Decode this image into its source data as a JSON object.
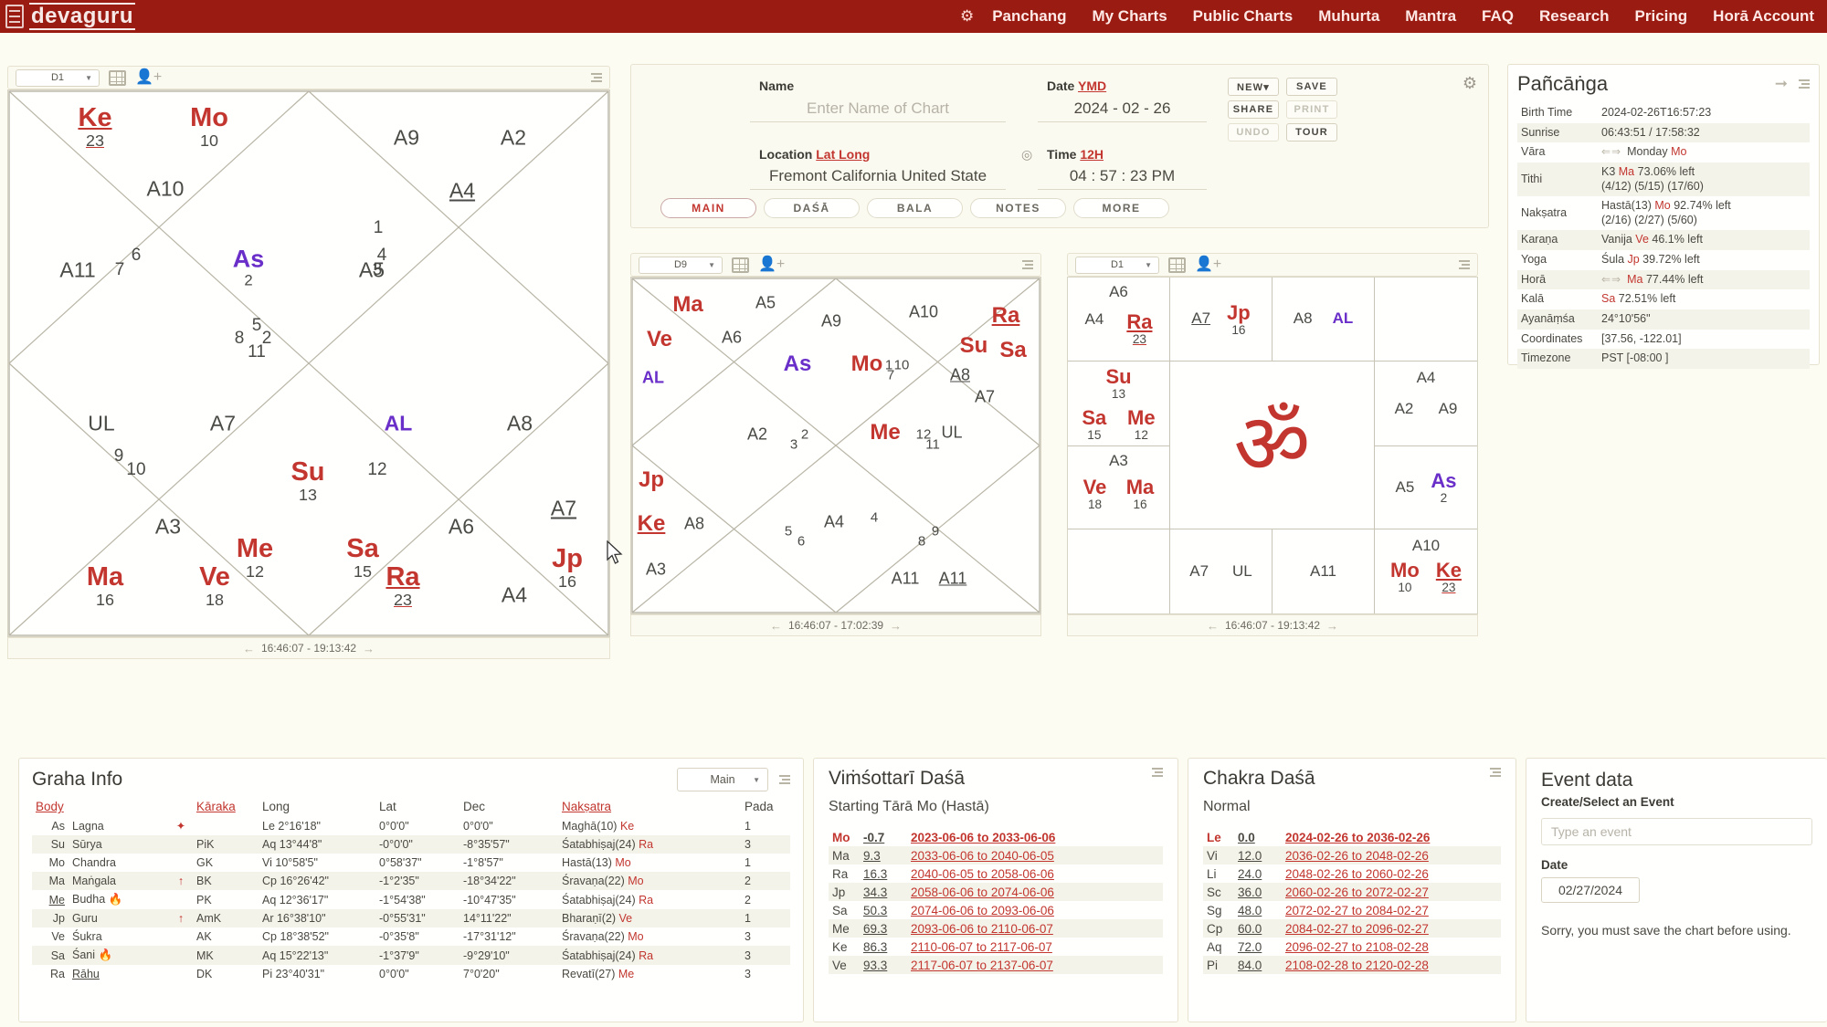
{
  "app": {
    "brand": "devaguru",
    "nav": [
      {
        "label": "Panchang"
      },
      {
        "label": "My Charts"
      },
      {
        "label": "Public Charts"
      },
      {
        "label": "Muhurta"
      },
      {
        "label": "Mantra"
      },
      {
        "label": "FAQ"
      },
      {
        "label": "Research"
      },
      {
        "label": "Pricing"
      },
      {
        "label": "Horā Account"
      }
    ],
    "nav_gear_icon": "gear-icon"
  },
  "form": {
    "name_label": "Name",
    "name_placeholder": "Enter Name of Chart",
    "name_value": "",
    "location_label": "Location",
    "location_link": "Lat Long",
    "location_value": "Fremont California United State",
    "date_label": "Date",
    "date_format_link": "YMD",
    "date_value": "2024 - 02 - 26",
    "time_label": "Time",
    "time_format_link": "12H",
    "time_value": "04 : 57 : 23",
    "time_meridiem": "PM",
    "buttons": [
      {
        "label": "NEW▾",
        "enabled": true
      },
      {
        "label": "SAVE",
        "enabled": true
      },
      {
        "label": "SHARE",
        "enabled": true
      },
      {
        "label": "PRINT",
        "enabled": false
      },
      {
        "label": "UNDO",
        "enabled": false
      },
      {
        "label": "TOUR",
        "enabled": true
      }
    ],
    "tabs": [
      {
        "label": "MAIN",
        "active": true
      },
      {
        "label": "DAŚĀ",
        "active": false
      },
      {
        "label": "BALA",
        "active": false
      },
      {
        "label": "NOTES",
        "active": false
      },
      {
        "label": "MORE",
        "active": false
      }
    ],
    "settings_icon": "gear-icon",
    "locate_icon": "crosshair-icon"
  },
  "panchanga": {
    "title": "Pañcāṅga",
    "forward_icon": "arrow-right-icon",
    "menu_icon": "kebab-menu-icon",
    "rows": [
      {
        "key": "Birth Time",
        "value": "2024-02-26T16:57:23"
      },
      {
        "key": "Sunrise",
        "value": "06:43:51 / 17:58:32"
      },
      {
        "key": "Vāra",
        "arrows": true,
        "value": "Monday ",
        "accent": "Mo"
      },
      {
        "key": "Tithi",
        "value": "K3 ",
        "accent": "Ma",
        "value2": " 73.06% left",
        "line2": "(4/12) (5/15) (17/60)"
      },
      {
        "key": "Nakṣatra",
        "value": "Hastā(13) ",
        "accent": "Mo",
        "value2": " 92.74% left",
        "line2": "(2/16) (2/27) (5/60)"
      },
      {
        "key": "Karaṇa",
        "value": "Vanija ",
        "accent": "Ve",
        "value2": " 46.1% left"
      },
      {
        "key": "Yoga",
        "value": "Śula ",
        "accent": "Jp",
        "value2": " 39.72% left"
      },
      {
        "key": "Horā",
        "arrows": true,
        "value": "",
        "accent": "Ma",
        "value2": " 77.44% left"
      },
      {
        "key": "Kalā",
        "value": "",
        "accent": "Sa",
        "value2": " 72.51% left"
      },
      {
        "key": "Ayanāṃśa",
        "value": "24°10'56\""
      },
      {
        "key": "Coordinates",
        "value": "[37.56, -122.01]"
      },
      {
        "key": "Timezone",
        "value": "PST [-08:00 ]"
      }
    ]
  },
  "chart_d1_north": {
    "varga": "D1",
    "style": "north-indian",
    "footer": "16:46:07 - 19:13:42",
    "house_numbers": [
      "1",
      "2",
      "3",
      "4",
      "5",
      "6",
      "7",
      "8",
      "9",
      "10",
      "11",
      "12"
    ],
    "items": [
      {
        "text": "Ke",
        "deg": "23",
        "kind": "gr-u"
      },
      {
        "text": "Mo",
        "deg": "10",
        "kind": "gr"
      },
      {
        "text": "A9",
        "kind": "ar"
      },
      {
        "text": "A2",
        "kind": "ar"
      },
      {
        "text": "A10",
        "kind": "ar"
      },
      {
        "text": "A4",
        "kind": "ar-u"
      },
      {
        "text": "A11",
        "kind": "ar"
      },
      {
        "text": "As",
        "deg": "2",
        "kind": "asc"
      },
      {
        "text": "A5",
        "kind": "ar"
      },
      {
        "text": "UL",
        "kind": "ar"
      },
      {
        "text": "A7",
        "kind": "ar"
      },
      {
        "text": "AL",
        "kind": "al"
      },
      {
        "text": "A8",
        "kind": "ar"
      },
      {
        "text": "Su",
        "deg": "13",
        "kind": "gr"
      },
      {
        "text": "A7",
        "kind": "ar-u"
      },
      {
        "text": "Me",
        "deg": "12",
        "kind": "gr"
      },
      {
        "text": "Sa",
        "deg": "15",
        "kind": "gr"
      },
      {
        "text": "Jp",
        "deg": "16",
        "kind": "gr"
      },
      {
        "text": "A3",
        "kind": "ar"
      },
      {
        "text": "A6",
        "kind": "ar"
      },
      {
        "text": "Ma",
        "deg": "16",
        "kind": "gr"
      },
      {
        "text": "Ve",
        "deg": "18",
        "kind": "gr"
      },
      {
        "text": "Ra",
        "deg": "23",
        "kind": "gr-u"
      },
      {
        "text": "A4",
        "kind": "ar"
      }
    ]
  },
  "chart_d9_north": {
    "varga": "D9",
    "style": "north-indian",
    "footer": "16:46:07 - 17:02:39",
    "items": [
      {
        "text": "Ma",
        "kind": "gr"
      },
      {
        "text": "A5",
        "kind": "ar"
      },
      {
        "text": "A10",
        "kind": "ar"
      },
      {
        "text": "Ra",
        "kind": "gr-u"
      },
      {
        "text": "Ve",
        "kind": "gr"
      },
      {
        "text": "A6",
        "kind": "ar"
      },
      {
        "text": "A9",
        "kind": "ar"
      },
      {
        "text": "Su",
        "kind": "gr"
      },
      {
        "text": "Sa",
        "kind": "gr"
      },
      {
        "text": "AL",
        "kind": "al"
      },
      {
        "text": "As",
        "kind": "asc"
      },
      {
        "text": "Mo",
        "kind": "gr"
      },
      {
        "text": "A8",
        "kind": "ar-u"
      },
      {
        "text": "A7",
        "kind": "ar"
      },
      {
        "text": "A2",
        "kind": "ar"
      },
      {
        "text": "Me",
        "kind": "gr"
      },
      {
        "text": "UL",
        "kind": "ar"
      },
      {
        "text": "Jp",
        "kind": "gr"
      },
      {
        "text": "Ke",
        "kind": "gr-u"
      },
      {
        "text": "A8",
        "kind": "ar"
      },
      {
        "text": "A4",
        "kind": "ar"
      },
      {
        "text": "A3",
        "kind": "ar"
      },
      {
        "text": "A11",
        "kind": "ar"
      },
      {
        "text": "A11",
        "kind": "ar-u"
      }
    ]
  },
  "chart_d1_south": {
    "varga": "D1",
    "style": "south-indian",
    "footer": "16:46:07 - 19:13:42",
    "center_glyph": "ॐ",
    "cells": [
      {
        "pos": "r1c1",
        "items": [
          {
            "text": "A6",
            "kind": "ar"
          },
          {
            "text": "A4",
            "kind": "ar"
          },
          {
            "text": "Ra",
            "deg": "23",
            "kind": "gr-u"
          }
        ]
      },
      {
        "pos": "r1c2",
        "items": [
          {
            "text": "A7",
            "kind": "ar-u"
          },
          {
            "text": "Jp",
            "deg": "16",
            "kind": "gr"
          }
        ]
      },
      {
        "pos": "r1c3",
        "items": [
          {
            "text": "A8",
            "kind": "ar"
          },
          {
            "text": "AL",
            "kind": "al"
          }
        ]
      },
      {
        "pos": "r1c4",
        "items": []
      },
      {
        "pos": "r2c1",
        "items": [
          {
            "text": "Su",
            "deg": "13",
            "kind": "gr"
          },
          {
            "text": "Sa",
            "deg": "15",
            "kind": "gr"
          },
          {
            "text": "Me",
            "deg": "12",
            "kind": "gr"
          }
        ]
      },
      {
        "pos": "r2c4",
        "items": [
          {
            "text": "A4",
            "kind": "ar"
          },
          {
            "text": "A2",
            "kind": "ar"
          },
          {
            "text": "A9",
            "kind": "ar"
          }
        ]
      },
      {
        "pos": "r3c1",
        "items": [
          {
            "text": "A3",
            "kind": "ar"
          },
          {
            "text": "Ve",
            "deg": "18",
            "kind": "gr"
          },
          {
            "text": "Ma",
            "deg": "16",
            "kind": "gr"
          }
        ]
      },
      {
        "pos": "r3c4",
        "items": [
          {
            "text": "A5",
            "kind": "ar"
          },
          {
            "text": "As",
            "deg": "2",
            "kind": "asc"
          }
        ]
      },
      {
        "pos": "r4c1",
        "items": []
      },
      {
        "pos": "r4c2",
        "items": [
          {
            "text": "A7",
            "kind": "ar"
          },
          {
            "text": "UL",
            "kind": "ar"
          }
        ]
      },
      {
        "pos": "r4c3",
        "items": [
          {
            "text": "A11",
            "kind": "ar"
          }
        ]
      },
      {
        "pos": "r4c4",
        "items": [
          {
            "text": "A10",
            "kind": "ar"
          },
          {
            "text": "Mo",
            "deg": "10",
            "kind": "gr"
          },
          {
            "text": "Ke",
            "deg": "23",
            "kind": "gr-u"
          }
        ]
      }
    ]
  },
  "graha_info": {
    "title": "Graha Info",
    "selector": "Main",
    "menu_icon": "kebab-menu-icon",
    "columns": [
      "Body",
      "",
      "",
      "Kāraka",
      "Long",
      "Lat",
      "Dec",
      "Nakṣatra",
      "Pada"
    ],
    "rows": [
      {
        "abbr": "As",
        "abbr_u": false,
        "name": "Lagna",
        "flag": "",
        "karaka": "",
        "marker": "lagna-star-icon",
        "long": "Le 2°16'18\"",
        "lat": "0°0'0\"",
        "dec": "0°0'0\"",
        "nak": "Maghā(10) ",
        "nak_lord": "Ke",
        "pada": "1"
      },
      {
        "abbr": "Su",
        "abbr_u": false,
        "name": "Sūrya",
        "flag": "",
        "karaka": "PiK",
        "marker": "",
        "long": "Aq 13°44'8\"",
        "lat": "-0°0'0\"",
        "dec": "-8°35'57\"",
        "nak": "Śatabhiṣaj(24) ",
        "nak_lord": "Ra",
        "pada": "3"
      },
      {
        "abbr": "Mo",
        "abbr_u": false,
        "name": "Chandra",
        "flag": "",
        "karaka": "GK",
        "marker": "",
        "long": "Vi 10°58'5\"",
        "lat": "0°58'37\"",
        "dec": "-1°8'57\"",
        "nak": "Hastā(13) ",
        "nak_lord": "Mo",
        "pada": "1"
      },
      {
        "abbr": "Ma",
        "abbr_u": false,
        "name": "Maṅgala",
        "flag": "",
        "karaka": "BK",
        "marker": "up-arrow-icon",
        "long": "Cp 16°26'42\"",
        "lat": "-1°2'35\"",
        "dec": "-18°34'22\"",
        "nak": "Śravaṇa(22) ",
        "nak_lord": "Mo",
        "pada": "2"
      },
      {
        "abbr": "Me",
        "abbr_u": true,
        "name": "Budha",
        "flag": "flame-icon",
        "karaka": "PK",
        "marker": "",
        "long": "Aq 12°36'17\"",
        "lat": "-1°54'38\"",
        "dec": "-10°47'35\"",
        "nak": "Śatabhiṣaj(24) ",
        "nak_lord": "Ra",
        "pada": "2"
      },
      {
        "abbr": "Jp",
        "abbr_u": false,
        "name": "Guru",
        "flag": "",
        "karaka": "AmK",
        "marker": "up-arrow-icon",
        "long": "Ar 16°38'10\"",
        "lat": "-0°55'31\"",
        "dec": "14°11'22\"",
        "nak": "Bharaṇī(2) ",
        "nak_lord": "Ve",
        "pada": "1"
      },
      {
        "abbr": "Ve",
        "abbr_u": false,
        "name": "Śukra",
        "flag": "",
        "karaka": "AK",
        "marker": "",
        "long": "Cp 18°38'52\"",
        "lat": "-0°35'8\"",
        "dec": "-17°31'12\"",
        "nak": "Śravaṇa(22) ",
        "nak_lord": "Mo",
        "pada": "3"
      },
      {
        "abbr": "Sa",
        "abbr_u": false,
        "name": "Śani",
        "flag": "flame-icon",
        "karaka": "MK",
        "marker": "",
        "long": "Aq 15°22'13\"",
        "lat": "-1°37'9\"",
        "dec": "-9°29'10\"",
        "nak": "Śatabhiṣaj(24) ",
        "nak_lord": "Ra",
        "pada": "3"
      },
      {
        "abbr": "Ra",
        "abbr_u": true,
        "name": "Rāhu",
        "flag": "",
        "karaka": "DK",
        "marker": "",
        "long": "Pi 23°40'31\"",
        "lat": "0°0'0\"",
        "dec": "7°0'20\"",
        "nak": "Revatī(27) ",
        "nak_lord": "Me",
        "pada": "3"
      }
    ]
  },
  "vimsottari": {
    "title": "Viṁśottarī Daśā",
    "subtitle": "Starting Tārā Mo (Hastā)",
    "menu_icon": "kebab-menu-icon",
    "rows": [
      {
        "lord": "Mo",
        "num": "-0.7",
        "range": "2023-06-06 to 2033-06-06"
      },
      {
        "lord": "Ma",
        "num": "9.3",
        "range": "2033-06-06 to 2040-06-05"
      },
      {
        "lord": "Ra",
        "num": "16.3",
        "range": "2040-06-05 to 2058-06-06"
      },
      {
        "lord": "Jp",
        "num": "34.3",
        "range": "2058-06-06 to 2074-06-06"
      },
      {
        "lord": "Sa",
        "num": "50.3",
        "range": "2074-06-06 to 2093-06-06"
      },
      {
        "lord": "Me",
        "num": "69.3",
        "range": "2093-06-06 to 2110-06-07"
      },
      {
        "lord": "Ke",
        "num": "86.3",
        "range": "2110-06-07 to 2117-06-07"
      },
      {
        "lord": "Ve",
        "num": "93.3",
        "range": "2117-06-07 to 2137-06-07"
      }
    ]
  },
  "chakra": {
    "title": "Chakra Daśā",
    "subtitle": "Normal",
    "menu_icon": "kebab-menu-icon",
    "rows": [
      {
        "lord": "Le",
        "num": "0.0",
        "range": "2024-02-26 to 2036-02-26"
      },
      {
        "lord": "Vi",
        "num": "12.0",
        "range": "2036-02-26 to 2048-02-26"
      },
      {
        "lord": "Li",
        "num": "24.0",
        "range": "2048-02-26 to 2060-02-26"
      },
      {
        "lord": "Sc",
        "num": "36.0",
        "range": "2060-02-26 to 2072-02-27"
      },
      {
        "lord": "Sg",
        "num": "48.0",
        "range": "2072-02-27 to 2084-02-27"
      },
      {
        "lord": "Cp",
        "num": "60.0",
        "range": "2084-02-27 to 2096-02-27"
      },
      {
        "lord": "Aq",
        "num": "72.0",
        "range": "2096-02-27 to 2108-02-28"
      },
      {
        "lord": "Pi",
        "num": "84.0",
        "range": "2108-02-28 to 2120-02-28"
      }
    ]
  },
  "event": {
    "title": "Event data",
    "subtitle": "Create/Select an Event",
    "input_placeholder": "Type an event",
    "input_value": "",
    "date_label": "Date",
    "date_value": "02/27/2024",
    "note": "Sorry, you must save the chart before using."
  },
  "colors": {
    "brand_red": "#9a1b12",
    "graha_red": "#c2362f",
    "ascendant_purple": "#6a2fc9",
    "page_bg": "#fdfcf2"
  }
}
